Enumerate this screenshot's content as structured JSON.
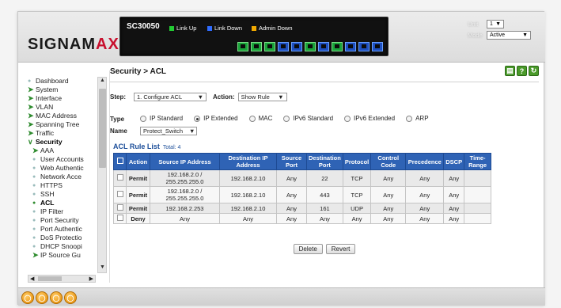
{
  "header": {
    "logo_main": "SIGNAM",
    "logo_accent": "AX",
    "device_model": "SC30050",
    "legend": [
      {
        "label": "Link Up",
        "color": "#22cc33"
      },
      {
        "label": "Link Down",
        "color": "#2f6cff"
      },
      {
        "label": "Admin Down",
        "color": "#f2a900"
      }
    ],
    "ports": [
      "up",
      "up",
      "up",
      "down",
      "down",
      "up",
      "down",
      "up",
      "down",
      "down",
      "down"
    ],
    "unit_label": "Unit",
    "unit_value": "1",
    "mode_label": "Mode",
    "mode_value": "Active"
  },
  "sidebar": {
    "items": [
      {
        "label": "Dashboard",
        "type": "dot"
      },
      {
        "label": "System",
        "type": "arrow"
      },
      {
        "label": "Interface",
        "type": "arrow"
      },
      {
        "label": "VLAN",
        "type": "arrow"
      },
      {
        "label": "MAC Address",
        "type": "arrow"
      },
      {
        "label": "Spanning Tree",
        "type": "arrow"
      },
      {
        "label": "Traffic",
        "type": "arrow"
      },
      {
        "label": "Security",
        "type": "open"
      },
      {
        "label": "AAA",
        "type": "sub-arrow"
      },
      {
        "label": "User Accounts",
        "type": "sub-dot"
      },
      {
        "label": "Web Authentic",
        "type": "sub-dot"
      },
      {
        "label": "Network Acce",
        "type": "sub-dot"
      },
      {
        "label": "HTTPS",
        "type": "sub-dot"
      },
      {
        "label": "SSH",
        "type": "sub-dot"
      },
      {
        "label": "ACL",
        "type": "sub-active"
      },
      {
        "label": "IP Filter",
        "type": "sub-dot"
      },
      {
        "label": "Port Security",
        "type": "sub-dot"
      },
      {
        "label": "Port Authentic",
        "type": "sub-dot"
      },
      {
        "label": "DoS Protectio",
        "type": "sub-dot"
      },
      {
        "label": "DHCP Snoopi",
        "type": "sub-dot"
      },
      {
        "label": "IP Source Gu",
        "type": "sub-arrow"
      }
    ]
  },
  "main": {
    "breadcrumb": "Security > ACL",
    "step_label": "Step:",
    "step_value": "1. Configure ACL",
    "action_label": "Action:",
    "action_value": "Show Rule",
    "type_label": "Type",
    "type_options": [
      {
        "label": "IP Standard",
        "selected": false
      },
      {
        "label": "IP Extended",
        "selected": true
      },
      {
        "label": "MAC",
        "selected": false
      },
      {
        "label": "IPv6 Standard",
        "selected": false
      },
      {
        "label": "IPv6 Extended",
        "selected": false
      },
      {
        "label": "ARP",
        "selected": false
      }
    ],
    "name_label": "Name",
    "name_value": "Protect_Switch",
    "list_title": "ACL Rule List",
    "list_total": "Total: 4",
    "columns": [
      "Action",
      "Source IP Address",
      "Destination IP Address",
      "Source Port",
      "Destination Port",
      "Protocol",
      "Control Code",
      "Precedence",
      "DSCP",
      "Time-Range"
    ],
    "rows": [
      [
        "Permit",
        "192.168.2.0 / 255.255.255.0",
        "192.168.2.10",
        "Any",
        "22",
        "TCP",
        "Any",
        "Any",
        "Any",
        ""
      ],
      [
        "Permit",
        "192.168.2.0 / 255.255.255.0",
        "192.168.2.10",
        "Any",
        "443",
        "TCP",
        "Any",
        "Any",
        "Any",
        ""
      ],
      [
        "Permit",
        "192.168.2.253",
        "192.168.2.10",
        "Any",
        "161",
        "UDP",
        "Any",
        "Any",
        "Any",
        ""
      ],
      [
        "Deny",
        "Any",
        "Any",
        "Any",
        "Any",
        "Any",
        "Any",
        "Any",
        "Any",
        ""
      ]
    ],
    "delete_label": "Delete",
    "revert_label": "Revert"
  }
}
